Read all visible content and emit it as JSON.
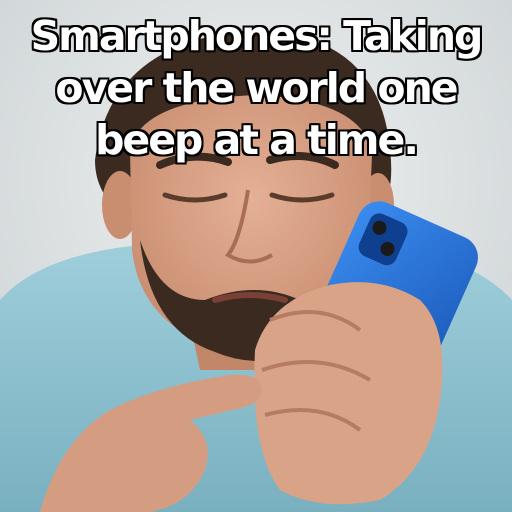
{
  "meme": {
    "caption_lines": [
      "Smartphones: Taking",
      "over the world one",
      "beep at a time."
    ]
  },
  "colors": {
    "background": "#dfe3e4",
    "shirt": "#8fc3d1",
    "skin": "#d9a387",
    "hair": "#3b2a20",
    "phone_case": "#1e6bd6",
    "caption_text": "#ffffff",
    "caption_outline": "#000000"
  }
}
